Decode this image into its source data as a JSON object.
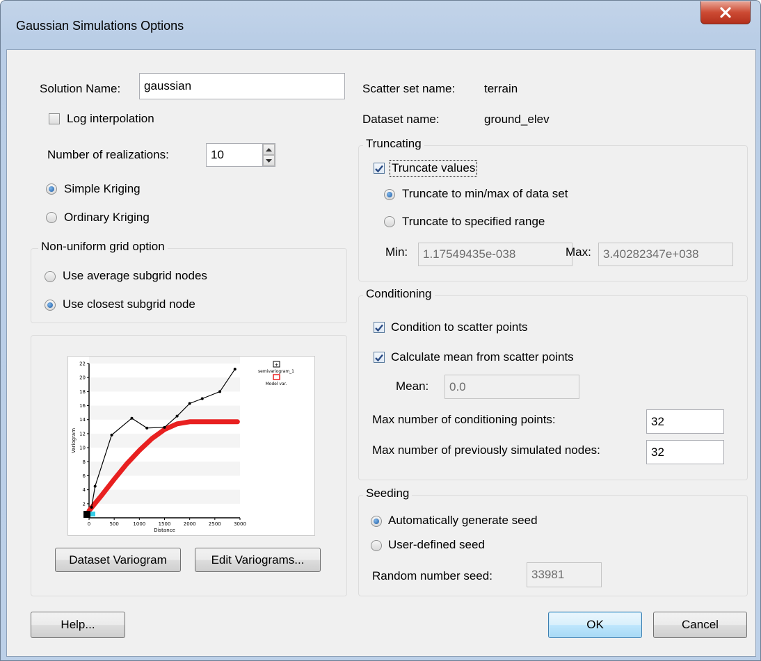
{
  "window": {
    "title": "Gaussian Simulations Options"
  },
  "icons": {
    "close": "close-icon",
    "check": "check-icon",
    "spin_up": "up-arrow-icon",
    "spin_down": "down-arrow-icon"
  },
  "colors": {
    "close_button": "#cc4a33",
    "default_button": "#bee6fd",
    "model_curve": "#e82020"
  },
  "left": {
    "solution_name_label": "Solution Name:",
    "solution_name_value": "gaussian",
    "log_interp_label": "Log interpolation",
    "log_interp_checked": false,
    "realizations_label": "Number of realizations:",
    "realizations_value": "10",
    "simple_kriging": "Simple Kriging",
    "ordinary_kriging": "Ordinary Kriging",
    "kriging_selected": "Simple Kriging",
    "nonuniform": {
      "title": "Non-uniform grid option",
      "avg": "Use average subgrid nodes",
      "closest": "Use closest subgrid node",
      "selected": "Use closest subgrid node"
    },
    "dataset_variogram_btn": "Dataset Variogram",
    "edit_variograms_btn": "Edit Variograms..."
  },
  "chart_data": {
    "type": "line",
    "xlabel": "Distance",
    "ylabel": "Variogram",
    "xlim": [
      0,
      3000
    ],
    "ylim": [
      0,
      22
    ],
    "x_ticks": [
      "0",
      "500",
      "1000",
      "1500",
      "2000",
      "2500",
      "3000"
    ],
    "y_ticks": [
      "2",
      "4",
      "6",
      "8",
      "10",
      "12",
      "14",
      "16",
      "18",
      "20",
      "22"
    ],
    "legend": [
      "semivariogram_1",
      "Model var."
    ],
    "series": [
      {
        "name": "semivariogram_1",
        "x": [
          50,
          120,
          450,
          850,
          1150,
          1500,
          1750,
          2000,
          2250,
          2600,
          2900
        ],
        "y": [
          1.5,
          4.5,
          11.8,
          14.2,
          12.8,
          12.9,
          14.5,
          16.3,
          17.0,
          18.0,
          21.2
        ]
      },
      {
        "name": "Model var.",
        "x": [
          0,
          250,
          500,
          750,
          1000,
          1250,
          1500,
          1750,
          2000,
          2250,
          2500,
          2750,
          2950
        ],
        "y": [
          1.0,
          3.2,
          5.5,
          7.7,
          9.6,
          11.3,
          12.6,
          13.4,
          13.7,
          13.7,
          13.7,
          13.7,
          13.7
        ]
      }
    ]
  },
  "right": {
    "scatter_label": "Scatter set  name:",
    "scatter_value": "terrain",
    "dataset_label": "Dataset name:",
    "dataset_value": "ground_elev",
    "truncating": {
      "title": "Truncating",
      "truncate_values": "Truncate values",
      "truncate_checked": true,
      "minmax": "Truncate to min/max of data set",
      "range": "Truncate to specified range",
      "selected": "Truncate to min/max of data set",
      "min_label": "Min:",
      "min_value": "1.17549435e-038",
      "max_label": "Max:",
      "max_value": "3.40282347e+038"
    },
    "conditioning": {
      "title": "Conditioning",
      "cond_scatter": "Condition to scatter points",
      "cond_checked": true,
      "calc_mean": "Calculate mean from scatter points",
      "calc_checked": true,
      "mean_label": "Mean:",
      "mean_value": "0.0",
      "max_cond_label": "Max number of conditioning points:",
      "max_cond_value": "32",
      "max_prev_label": "Max number of previously simulated nodes:",
      "max_prev_value": "32"
    },
    "seeding": {
      "title": "Seeding",
      "auto": "Automatically generate seed",
      "user": "User-defined seed",
      "selected": "Automatically generate seed",
      "random_label": "Random number seed:",
      "random_value": "33981"
    }
  },
  "footer": {
    "help": "Help...",
    "ok": "OK",
    "cancel": "Cancel"
  }
}
